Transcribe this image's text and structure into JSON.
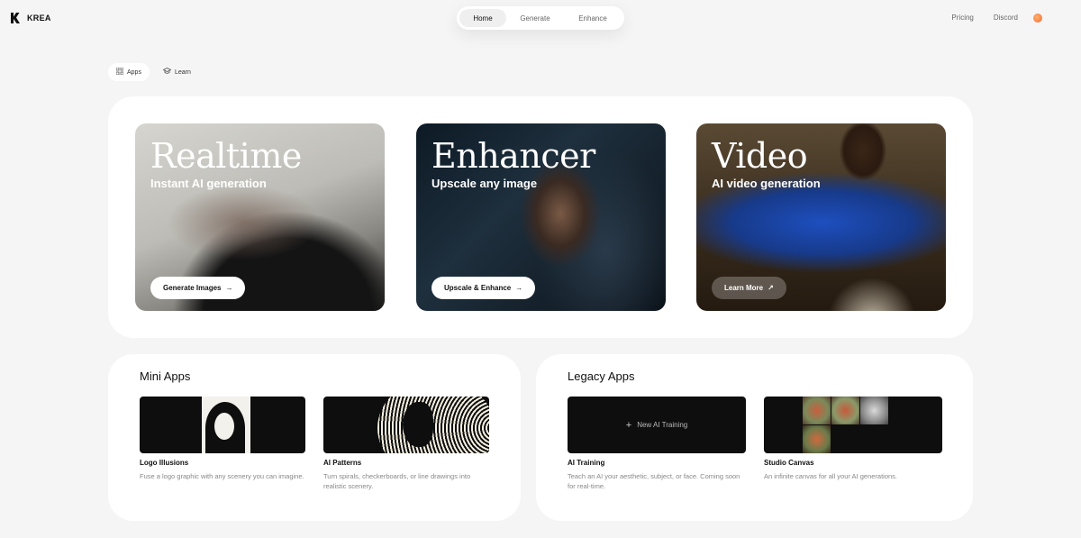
{
  "brand": {
    "name": "KREA"
  },
  "center_nav": {
    "home": "Home",
    "generate": "Generate",
    "enhance": "Enhance"
  },
  "right_nav": {
    "pricing": "Pricing",
    "discord": "Discord"
  },
  "subtabs": {
    "apps": "Apps",
    "learn": "Learn"
  },
  "hero": {
    "realtime": {
      "title": "Realtime",
      "subtitle": "Instant AI generation",
      "button": "Generate Images"
    },
    "enhancer": {
      "title": "Enhancer",
      "subtitle": "Upscale any image",
      "button": "Upscale & Enhance"
    },
    "video": {
      "title": "Video",
      "subtitle": "AI video generation",
      "button": "Learn More"
    }
  },
  "mini_apps": {
    "title": "Mini Apps",
    "items": [
      {
        "name": "Logo Illusions",
        "desc": "Fuse a logo graphic with any scenery you can imagine."
      },
      {
        "name": "AI Patterns",
        "desc": "Turn spirals, checkerboards, or line drawings into realistic scenery."
      }
    ]
  },
  "legacy_apps": {
    "title": "Legacy Apps",
    "items": [
      {
        "name": "AI Training",
        "desc": "Teach an AI your aesthetic, subject, or face. Coming soon for real-time.",
        "thumb_label": "New AI Training"
      },
      {
        "name": "Studio Canvas",
        "desc": "An infinite canvas for all your AI generations."
      }
    ]
  },
  "colors": {
    "background": "#f5f5f5",
    "panel": "#ffffff",
    "text": "#111111",
    "muted": "#888888"
  }
}
